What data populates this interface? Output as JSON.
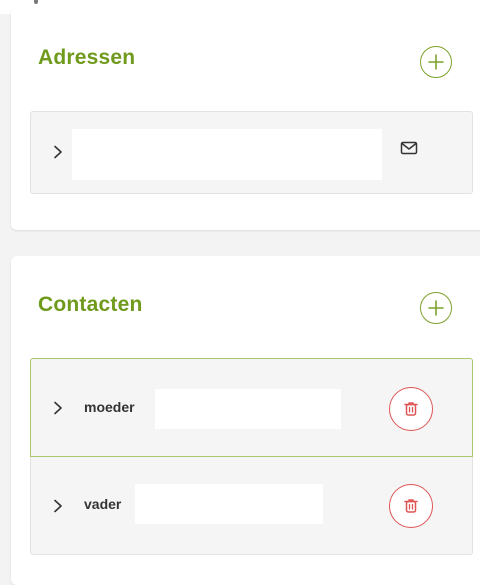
{
  "addresses": {
    "title": "Adressen",
    "add_icon": "plus-icon",
    "items": [
      {
        "expand_icon": "chevron-right-icon",
        "action_icon": "envelope-icon"
      }
    ]
  },
  "contacts": {
    "title": "Contacten",
    "add_icon": "plus-icon",
    "items": [
      {
        "label": "moeder",
        "expand_icon": "chevron-right-icon",
        "action_icon": "trash-icon"
      },
      {
        "label": "vader",
        "expand_icon": "chevron-right-icon",
        "action_icon": "trash-icon"
      }
    ]
  },
  "colors": {
    "accent": "#6f9a1c",
    "accent_border": "#7ea32a",
    "selected_border": "#a8c96a",
    "danger": "#e05454",
    "row_bg": "#f5f5f6"
  }
}
